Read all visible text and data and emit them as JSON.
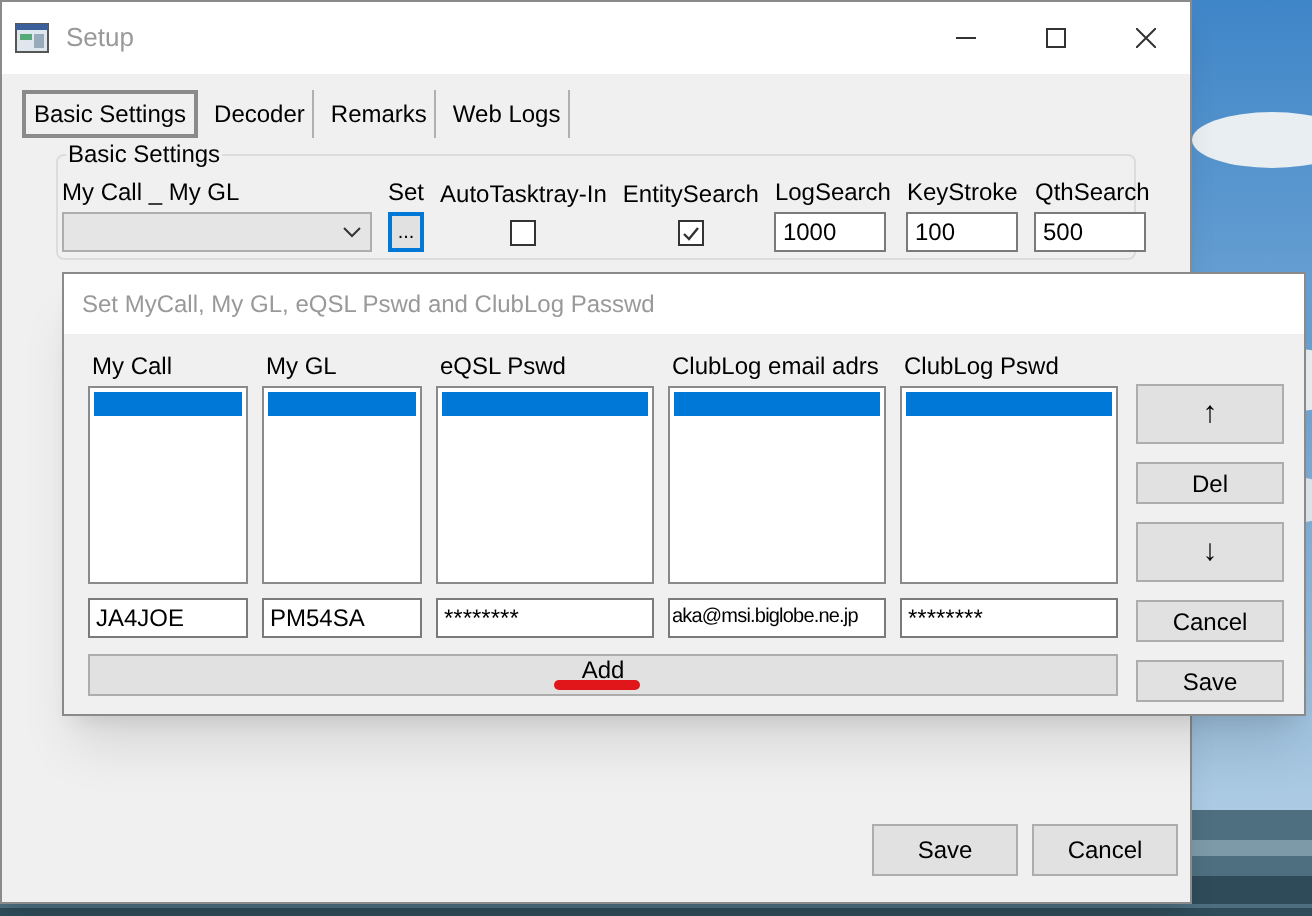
{
  "window": {
    "title": "Setup"
  },
  "tabs": [
    {
      "label": "Basic Settings",
      "selected": true
    },
    {
      "label": "Decoder",
      "selected": false
    },
    {
      "label": "Remarks",
      "selected": false
    },
    {
      "label": "Web Logs",
      "selected": false
    }
  ],
  "basic_settings": {
    "title": "Basic Settings",
    "fields": [
      {
        "kind": "combo",
        "label": "My Call _ My GL"
      },
      {
        "kind": "button",
        "label": "Set",
        "text": "..."
      },
      {
        "kind": "checkbox",
        "label": "AutoTasktray-In",
        "checked": false
      },
      {
        "kind": "checkbox",
        "label": "EntitySearch",
        "checked": true
      },
      {
        "kind": "input",
        "label": "LogSearch",
        "value": "1000"
      },
      {
        "kind": "input",
        "label": "KeyStroke",
        "value": "100"
      },
      {
        "kind": "input",
        "label": "QthSearch",
        "value": "500"
      }
    ]
  },
  "dialog": {
    "title": "Set MyCall, My GL, eQSL Pswd and ClubLog Passwd",
    "columns": [
      {
        "label": "My Call",
        "rows": [
          {
            "selected": true
          }
        ],
        "value": "JA4JOE"
      },
      {
        "label": "My GL",
        "rows": [
          {
            "selected": true
          }
        ],
        "value": "PM54SA"
      },
      {
        "label": "eQSL Pswd",
        "rows": [
          {
            "selected": true
          }
        ],
        "value": "********"
      },
      {
        "label": "ClubLog email adrs",
        "rows": [
          {
            "selected": true
          }
        ],
        "value": "aka@msi.biglobe.ne.jp"
      },
      {
        "label": "ClubLog Pswd",
        "rows": [
          {
            "selected": true
          }
        ],
        "value": "********"
      }
    ],
    "add_button": "Add",
    "side_buttons": [
      {
        "label": "↑",
        "kind": "tall"
      },
      {
        "label": "Del",
        "kind": "short"
      },
      {
        "label": "↓",
        "kind": "tall"
      },
      {
        "label": "Cancel",
        "kind": "short"
      },
      {
        "label": "Save",
        "kind": "short"
      }
    ]
  },
  "buttons": [
    "Save",
    "Cancel"
  ]
}
